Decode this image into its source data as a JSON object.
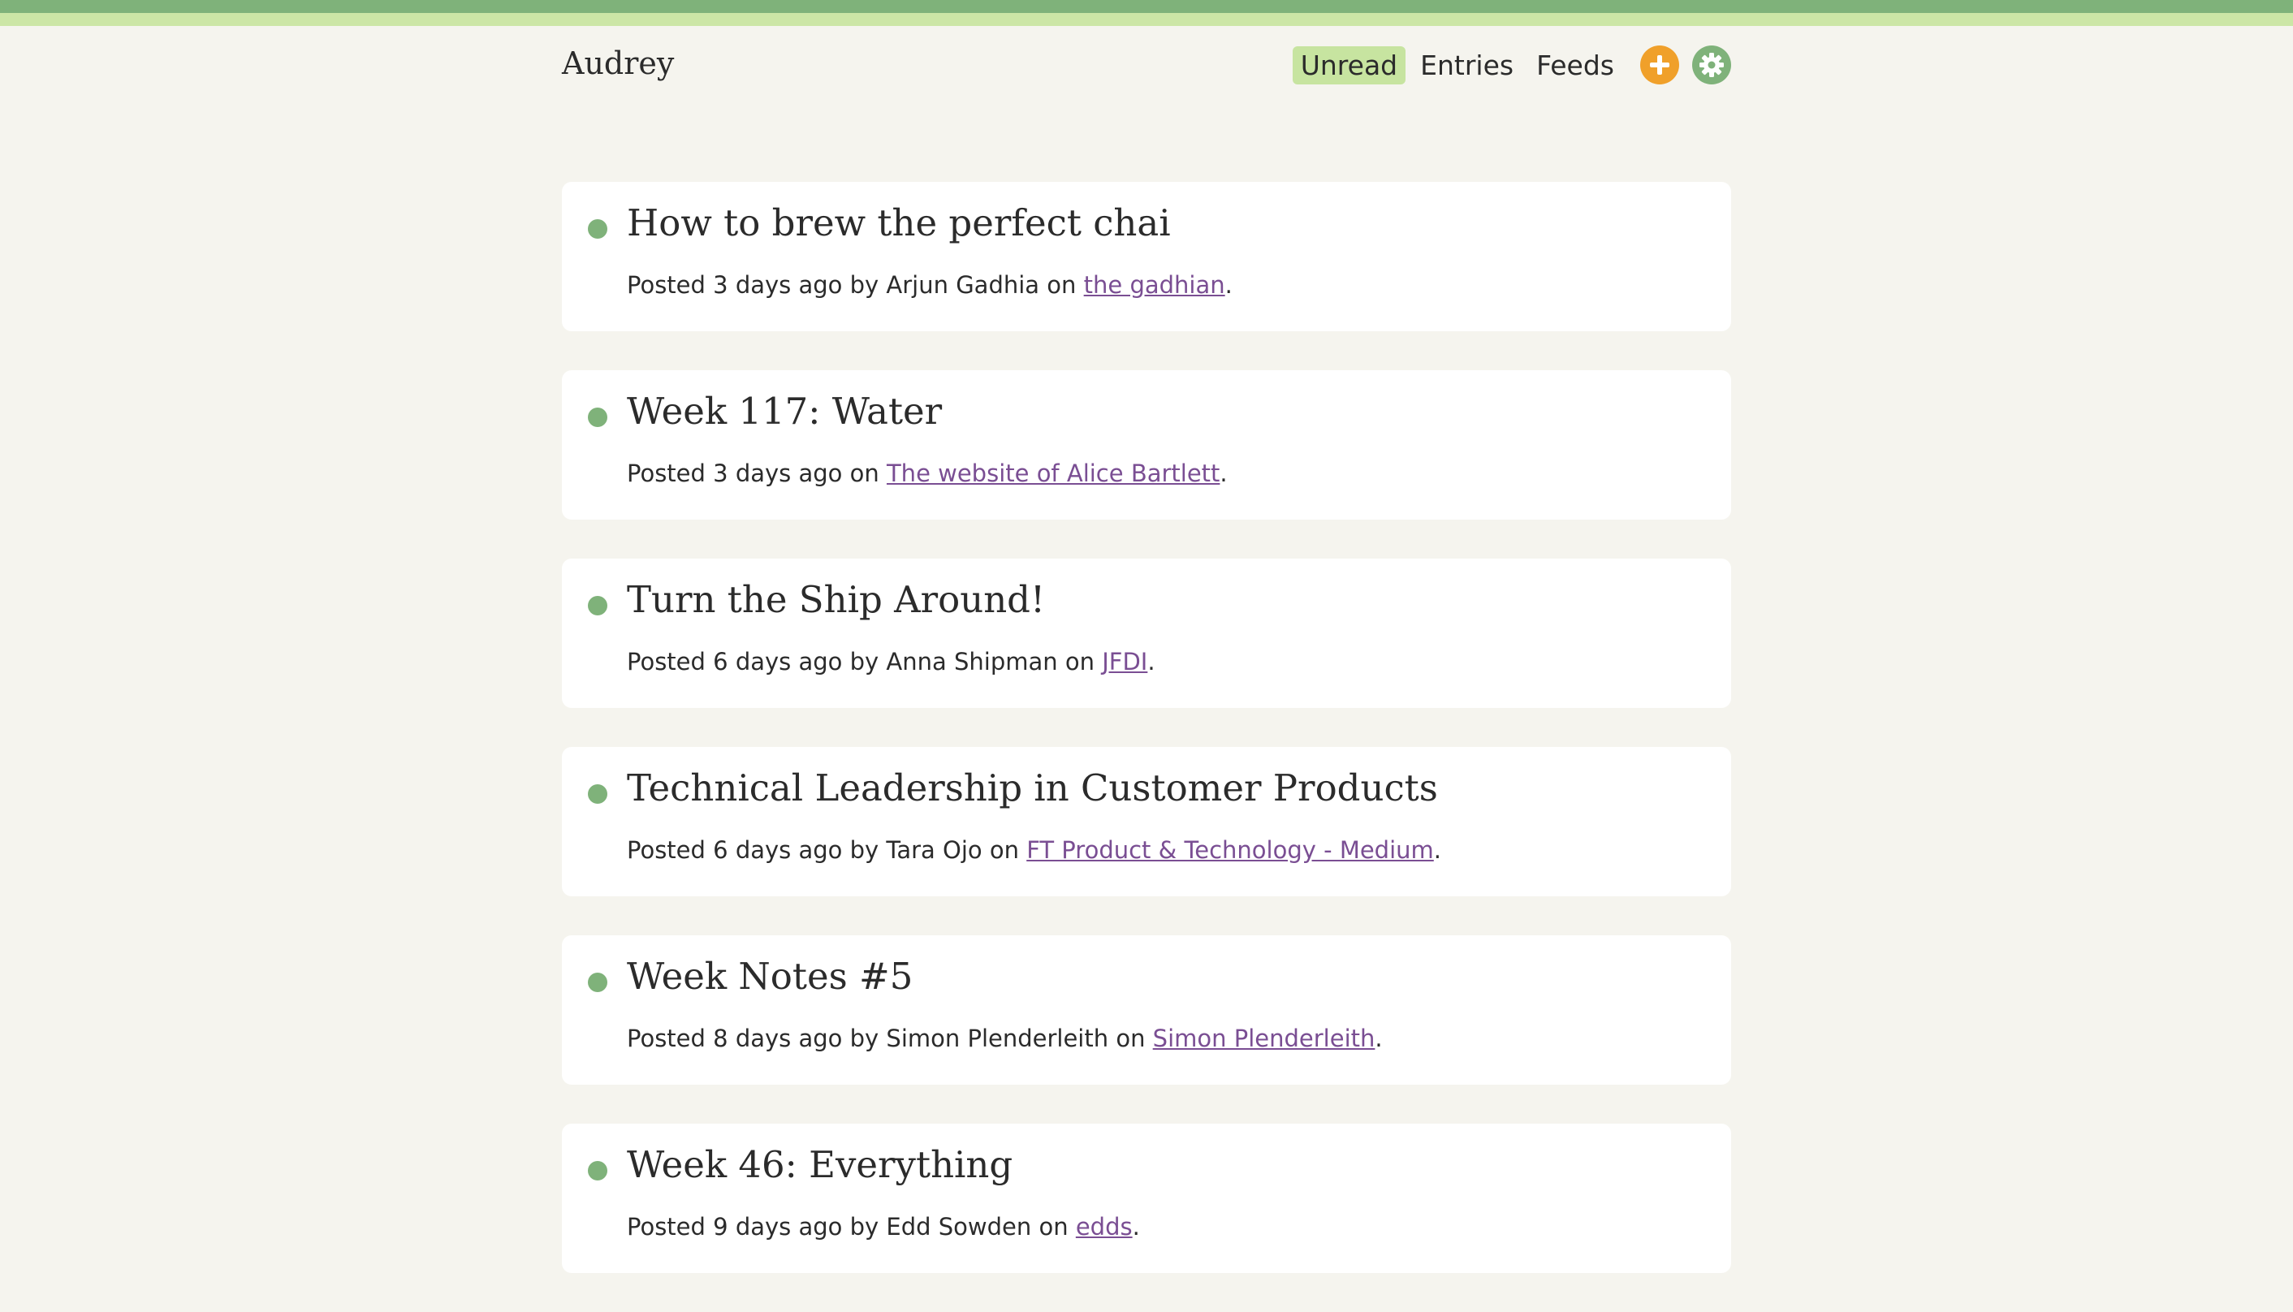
{
  "app": {
    "brand": "Audrey"
  },
  "nav": {
    "unread": "Unread",
    "entries": "Entries",
    "feeds": "Feeds",
    "add_icon": "plus-icon",
    "settings_icon": "gear-icon"
  },
  "colors": {
    "accent_green": "#7fb27a",
    "light_green": "#cce6a6",
    "orange": "#f0a02a",
    "link": "#7a4e93"
  },
  "entries": [
    {
      "title": "How to brew the perfect chai",
      "posted": "Posted 3 days ago by Arjun Gadhia on ",
      "feed": "the gadhian",
      "end": "."
    },
    {
      "title": "Week 117: Water",
      "posted": "Posted 3 days ago on ",
      "feed": "The website of Alice Bartlett",
      "end": "."
    },
    {
      "title": "Turn the Ship Around!",
      "posted": "Posted 6 days ago by Anna Shipman on ",
      "feed": "JFDI",
      "end": "."
    },
    {
      "title": "Technical Leadership in Customer Products",
      "posted": "Posted 6 days ago by Tara Ojo on ",
      "feed": "FT Product & Technology - Medium",
      "end": "."
    },
    {
      "title": "Week Notes #5",
      "posted": "Posted 8 days ago by Simon Plenderleith on ",
      "feed": "Simon Plenderleith",
      "end": "."
    },
    {
      "title": "Week 46: Everything",
      "posted": "Posted 9 days ago by Edd Sowden on ",
      "feed": "edds",
      "end": "."
    }
  ]
}
